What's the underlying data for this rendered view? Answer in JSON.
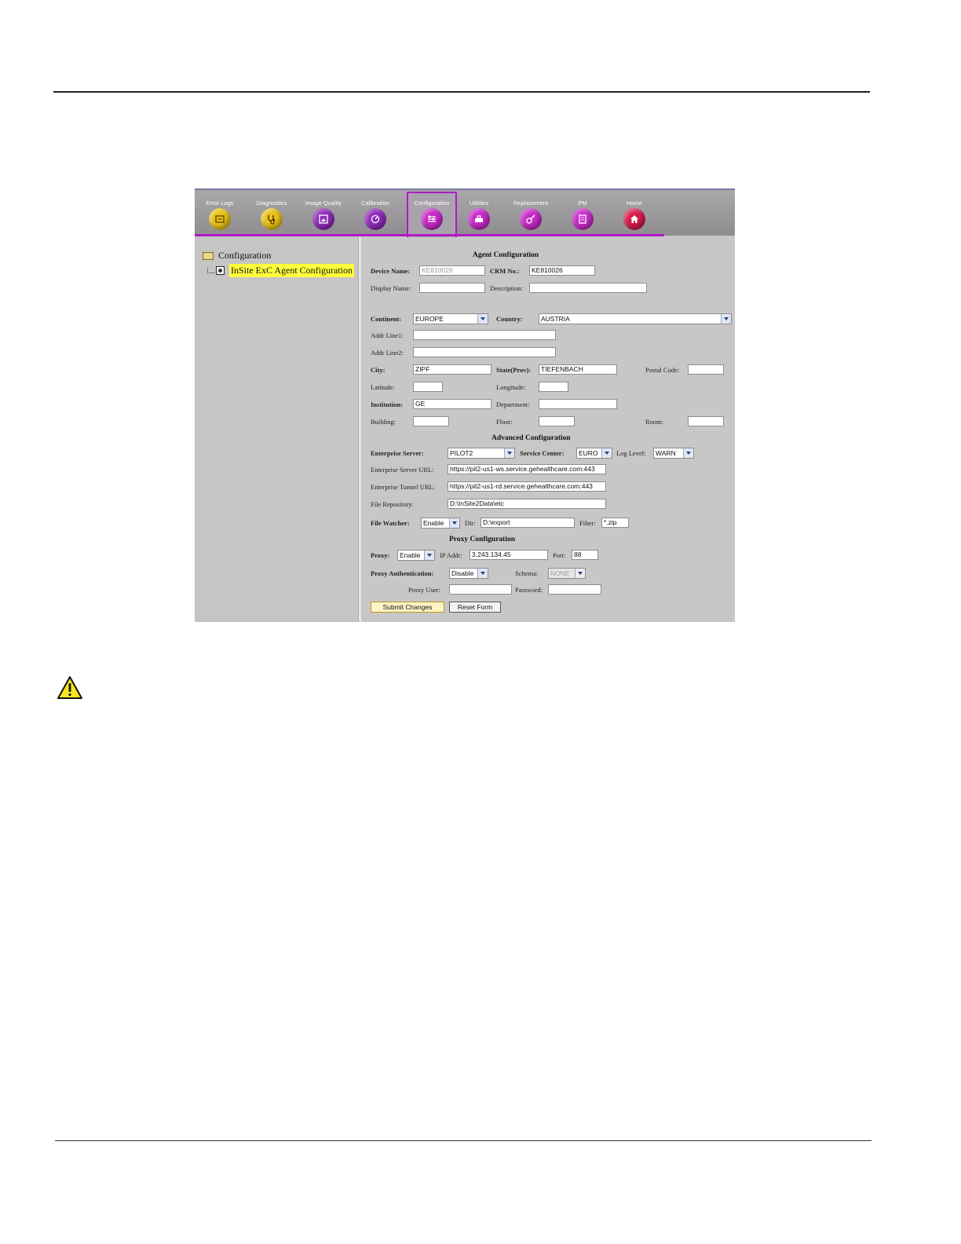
{
  "toolbar": {
    "tabs": [
      {
        "label": "Error Logs",
        "icon": "error-logs-icon",
        "color": "#e8c21a"
      },
      {
        "label": "Diagnostics",
        "icon": "stethoscope-icon",
        "color": "#e8c21a"
      },
      {
        "label": "Image Quality",
        "icon": "image-quality-icon",
        "color": "#8e2bb7"
      },
      {
        "label": "Calibration",
        "icon": "calibration-icon",
        "color": "#8e2bb7"
      },
      {
        "label": "Configuration",
        "icon": "configuration-icon",
        "color": "#c72bc7"
      },
      {
        "label": "Utilities",
        "icon": "utilities-icon",
        "color": "#c72bc7"
      },
      {
        "label": "Replacement",
        "icon": "replacement-icon",
        "color": "#c72bc7"
      },
      {
        "label": "PM",
        "icon": "pm-icon",
        "color": "#c72bc7"
      },
      {
        "label": "Home",
        "icon": "home-icon",
        "color": "#d61a4c"
      }
    ],
    "active_index": 4,
    "accent": "#b11ac4"
  },
  "tree": {
    "root": "Configuration",
    "child": "InSite ExC Agent Configuration"
  },
  "form": {
    "agent_heading": "Agent Configuration",
    "device_name_label": "Device Name:",
    "device_name_value": "KE810026",
    "crm_label": "CRM No.:",
    "crm_value": "KE810026",
    "display_name_label": "Display Name:",
    "display_name_value": "",
    "description_label": "Description:",
    "description_value": "",
    "continent_label": "Continent:",
    "continent_value": "EUROPE",
    "country_label": "Country:",
    "country_value": "AUSTRIA",
    "addr1_label": "Addr Line1:",
    "addr1_value": "",
    "addr2_label": "Addr Line2:",
    "addr2_value": "",
    "city_label": "City:",
    "city_value": "ZIPF",
    "state_label": "State(Prov):",
    "state_value": "TIEFENBACH",
    "postal_label": "Postal Code:",
    "postal_value": "",
    "latitude_label": "Latitude:",
    "latitude_value": "",
    "longitude_label": "Longitude:",
    "longitude_value": "",
    "institution_label": "Institution:",
    "institution_value": "GE",
    "department_label": "Department:",
    "department_value": "",
    "building_label": "Building:",
    "building_value": "",
    "floor_label": "Floor:",
    "floor_value": "",
    "room_label": "Room:",
    "room_value": "",
    "advanced_heading": "Advanced Configuration",
    "enterprise_server_label": "Enterprise Server:",
    "enterprise_server_value": "PILOT2",
    "service_center_label": "Service Center:",
    "service_center_value": "EURO",
    "log_level_label": "Log Level:",
    "log_level_value": "WARN",
    "server_url_label": "Enterprise Server URL:",
    "server_url_value": "https://pit2-us1-ws.service.gehealthcare.com:443",
    "tunnel_url_label": "Enterprise Tunnel URL:",
    "tunnel_url_value": "https://pit2-us1-rd.service.gehealthcare.com:443",
    "file_repo_label": "File Repository:",
    "file_repo_value": "D:\\InSite2Data\\etc",
    "file_watcher_label": "File Watcher:",
    "file_watcher_value": "Enable",
    "dir_label": "Dir:",
    "dir_value": "D:\\export",
    "filter_label": "Filter:",
    "filter_value": "*.zip",
    "proxy_heading": "Proxy Configuration",
    "proxy_label": "Proxy:",
    "proxy_value": "Enable",
    "ip_label": "IP Addr:",
    "ip_value": "3.243.134.45",
    "port_label": "Port:",
    "port_value": "88",
    "proxy_auth_label": "Proxy Authentication:",
    "proxy_auth_value": "Disable",
    "schema_label": "Schema:",
    "schema_value": "NONE",
    "proxy_user_label": "Proxy User:",
    "proxy_user_value": "",
    "password_label": "Password:",
    "password_value": "",
    "submit_label": "Submit Changes",
    "reset_label": "Reset Form"
  },
  "warning_icon": "warning-triangle-icon"
}
